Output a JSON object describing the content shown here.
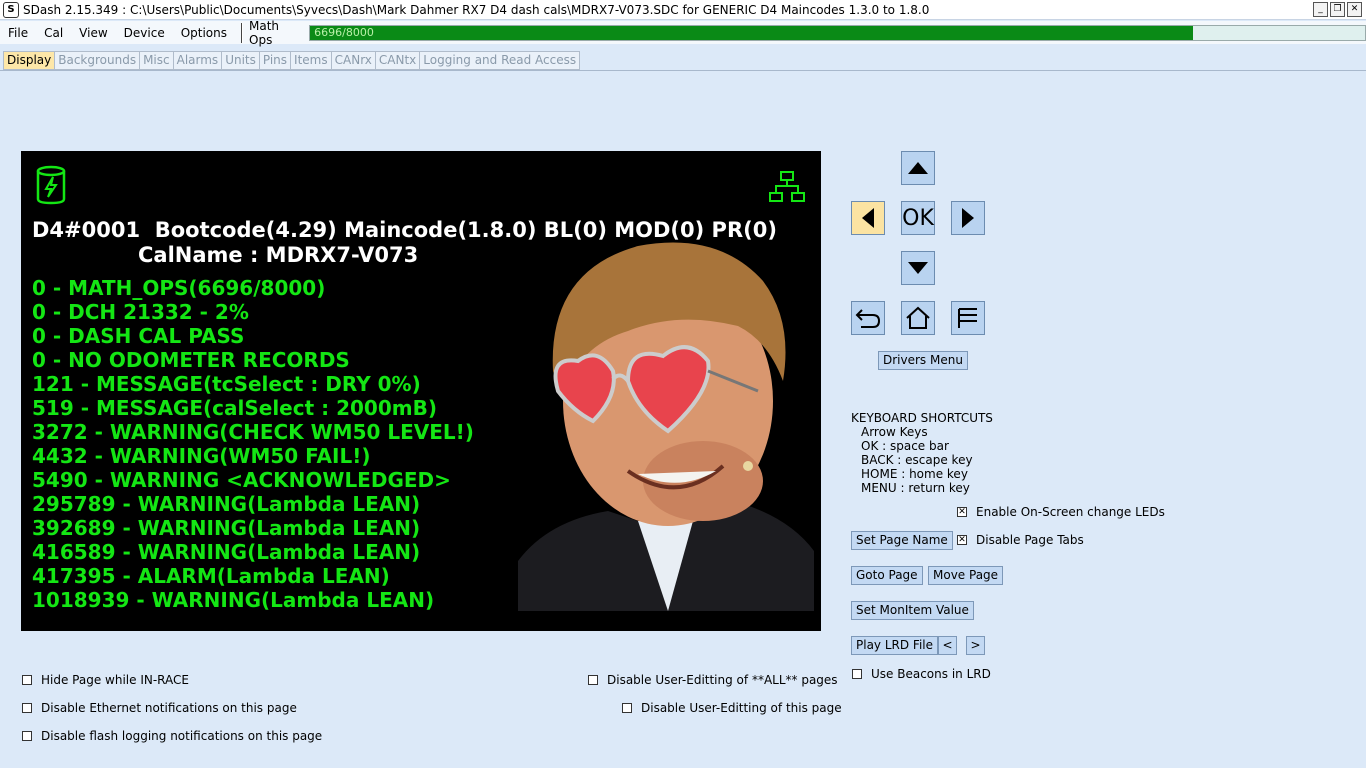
{
  "window": {
    "app_icon": "S",
    "title": "SDash 2.15.349  :  C:\\Users\\Public\\Documents\\Syvecs\\Dash\\Mark Dahmer RX7 D4 dash cals\\MDRX7-V073.SDC for GENERIC D4 Maincodes 1.3.0 to 1.8.0",
    "minimize_label": "_",
    "restore_label": "❐",
    "close_label": "✕"
  },
  "menu": {
    "items": [
      "File",
      "Cal",
      "View",
      "Device",
      "Options"
    ],
    "math_ops_label": "Math Ops",
    "math_ops_text": "6696/8000",
    "math_ops_fraction": 0.837
  },
  "tabs": [
    "Display",
    "Backgrounds",
    "Misc",
    "Alarms",
    "Units",
    "Pins",
    "Items",
    "CANrx",
    "CANtx",
    "Logging and Read Access"
  ],
  "dash": {
    "header_line1": "D4#0001  Bootcode(4.29) Maincode(1.8.0) BL(0) MOD(0) PR(0)",
    "header_line2": "CalName : MDRX7-V073",
    "messages": [
      "0 - MATH_OPS(6696/8000)",
      "0 - DCH 21332 - 2%",
      "0 - DASH CAL PASS",
      "0 - NO ODOMETER RECORDS",
      "121 - MESSAGE(tcSelect : DRY 0%)",
      "519 - MESSAGE(calSelect : 2000mB)",
      "3272 - WARNING(CHECK WM50 LEVEL!)",
      "4432 - WARNING(WM50 FAIL!)",
      "5490 - WARNING <ACKNOWLEDGED>",
      "295789 - WARNING(Lambda LEAN)",
      "392689 - WARNING(Lambda LEAN)",
      "416589 - WARNING(Lambda LEAN)",
      "417395 - ALARM(Lambda LEAN)",
      "1018939 - WARNING(Lambda LEAN)"
    ],
    "text_color": "#14e614",
    "icons": [
      "battery-charging-icon",
      "network-icon"
    ]
  },
  "nav": {
    "ok_label": "OK",
    "drivers_menu": "Drivers Menu",
    "icons": [
      "arrow-up-icon",
      "arrow-left-icon",
      "arrow-right-icon",
      "arrow-down-icon",
      "back-icon",
      "home-icon",
      "menu-icon"
    ]
  },
  "shortcuts": {
    "heading": "KEYBOARD SHORTCUTS",
    "lines": [
      "Arrow Keys",
      "OK : space bar",
      "BACK : escape key",
      "HOME : home key",
      "MENU : return key"
    ]
  },
  "options": {
    "enable_leds": "Enable On-Screen change LEDs",
    "disable_page_tabs": "Disable Page Tabs",
    "use_beacons": "Use Beacons in LRD",
    "hide_page": "Hide Page while IN-RACE",
    "disable_ethernet": "Disable Ethernet notifications on this page",
    "disable_flash": "Disable flash logging notifications on this page",
    "disable_all_editing": "Disable User-Editting of **ALL** pages",
    "disable_page_editing": "Disable User-Editting of this page"
  },
  "buttons": {
    "set_page_name": "Set Page Name",
    "goto_page": "Goto Page",
    "move_page": "Move Page",
    "set_monitem": "Set MonItem Value",
    "play_lrd": "Play LRD File",
    "prev": "<",
    "next": ">"
  }
}
